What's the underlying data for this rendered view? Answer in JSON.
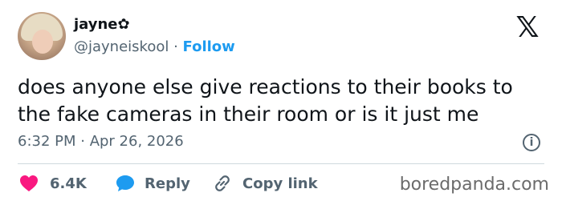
{
  "author": {
    "display_name": "jayne✿",
    "handle": "@jayneiskool",
    "separator": " · ",
    "follow_label": "Follow"
  },
  "x_logo": "𝕏",
  "tweet": {
    "text": "does anyone else give reactions to their books to the fake cameras in their room or is it just me"
  },
  "timestamp": "6:32 PM · Apr 26, 2026",
  "info_icon": "i",
  "actions": {
    "like_count": "6.4K",
    "reply_label": "Reply",
    "copy_link_label": "Copy link"
  },
  "watermark": "boredpanda.com",
  "colors": {
    "like": "#f91880",
    "reply": "#1d9bf0",
    "follow": "#1d9bf0",
    "muted": "#536471",
    "text": "#0f1419"
  },
  "icons": {
    "like": "heart-icon",
    "reply": "speech-bubble-icon",
    "copy": "link-icon",
    "info": "info-icon",
    "brand": "x-logo-icon"
  }
}
